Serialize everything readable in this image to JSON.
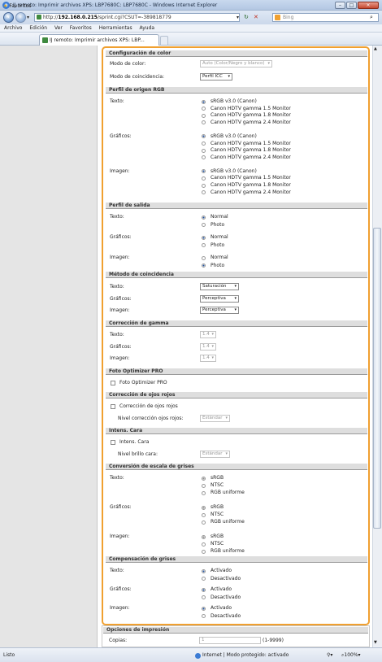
{
  "browser": {
    "title": "IJ remoto: Imprimir archivos XPS: LBP7680C: LBP7680C - Windows Internet Explorer",
    "url_prefix": "http://",
    "url_host": "192.168.0.215",
    "url_rest": "/sprint.cgi?CSUT=-389818779",
    "search_placeholder": "Bing",
    "menu": [
      "Archivo",
      "Edición",
      "Ver",
      "Favoritos",
      "Herramientas",
      "Ayuda"
    ],
    "favorites_label": "Favoritos",
    "tab_title": "IJ remoto: Imprimir archivos XPS: LBP...",
    "status_left": "Listo",
    "status_zone": "Internet | Modo protegido: activado",
    "zoom": "100%"
  },
  "form": {
    "color_config": {
      "title": "Configuración de color",
      "color_mode_label": "Modo de color:",
      "color_mode_value": "Auto (Color/Negro y blanco)",
      "matching_mode_label": "Modo de coincidencia:",
      "matching_mode_value": "Perfil ICC"
    },
    "rgb_profile": {
      "title": "Perfil de origen RGB",
      "groups": [
        {
          "label": "Texto:",
          "options": [
            "sRGB v3.0 (Canon)",
            "Canon HDTV gamma 1.5 Monitor",
            "Canon HDTV gamma 1.8 Monitor",
            "Canon HDTV gamma 2.4 Monitor"
          ],
          "selected": 0
        },
        {
          "label": "Gráficos:",
          "options": [
            "sRGB v3.0 (Canon)",
            "Canon HDTV gamma 1.5 Monitor",
            "Canon HDTV gamma 1.8 Monitor",
            "Canon HDTV gamma 2.4 Monitor"
          ],
          "selected": 0
        },
        {
          "label": "Imagen:",
          "options": [
            "sRGB v3.0 (Canon)",
            "Canon HDTV gamma 1.5 Monitor",
            "Canon HDTV gamma 1.8 Monitor",
            "Canon HDTV gamma 2.4 Monitor"
          ],
          "selected": 0
        }
      ]
    },
    "output_profile": {
      "title": "Perfil de salida",
      "groups": [
        {
          "label": "Texto:",
          "options": [
            "Normal",
            "Photo"
          ],
          "selected": 0
        },
        {
          "label": "Gráficos:",
          "options": [
            "Normal",
            "Photo"
          ],
          "selected": 0
        },
        {
          "label": "Imagen:",
          "options": [
            "Normal",
            "Photo"
          ],
          "selected": 1
        }
      ]
    },
    "matching_method": {
      "title": "Método de coincidencia",
      "rows": [
        {
          "label": "Texto:",
          "value": "Saturación"
        },
        {
          "label": "Gráficos:",
          "value": "Perceptiva"
        },
        {
          "label": "Imagen:",
          "value": "Perceptiva"
        }
      ]
    },
    "gamma": {
      "title": "Corrección de gamma",
      "rows": [
        {
          "label": "Texto:",
          "value": "1.4"
        },
        {
          "label": "Gráficos:",
          "value": "1.4"
        },
        {
          "label": "Imagen:",
          "value": "1.4"
        }
      ]
    },
    "photo_optimizer": {
      "title": "Foto Optimizer PRO",
      "checkbox_label": "Foto Optimizer PRO"
    },
    "redeye": {
      "title": "Corrección de ojos rojos",
      "checkbox_label": "Corrección de ojos rojos",
      "level_label": "Nivel corrección ojos rojos:",
      "level_value": "Estándar"
    },
    "face": {
      "title": "Intens. Cara",
      "checkbox_label": "Intens. Cara",
      "level_label": "Nivel brillo cara:",
      "level_value": "Estándar"
    },
    "grayscale": {
      "title": "Conversión de escala de grises",
      "groups": [
        {
          "label": "Texto:",
          "options": [
            "sRGB",
            "NTSC",
            "RGB uniforme"
          ],
          "selected": 0
        },
        {
          "label": "Gráficos:",
          "options": [
            "sRGB",
            "NTSC",
            "RGB uniforme"
          ],
          "selected": 0
        },
        {
          "label": "Imagen:",
          "options": [
            "sRGB",
            "NTSC",
            "RGB uniforme"
          ],
          "selected": 0
        }
      ]
    },
    "gray_comp": {
      "title": "Compensación de grises",
      "groups": [
        {
          "label": "Texto:",
          "options": [
            "Activado",
            "Desactivado"
          ],
          "selected": 0
        },
        {
          "label": "Gráficos:",
          "options": [
            "Activado",
            "Desactivado"
          ],
          "selected": 0
        },
        {
          "label": "Imagen:",
          "options": [
            "Activado",
            "Desactivado"
          ],
          "selected": 0
        }
      ]
    },
    "print_options": {
      "title": "Opciones de impresión",
      "copies_label": "Copias:",
      "copies_value": "1",
      "copies_range": "(1-9999)"
    }
  }
}
